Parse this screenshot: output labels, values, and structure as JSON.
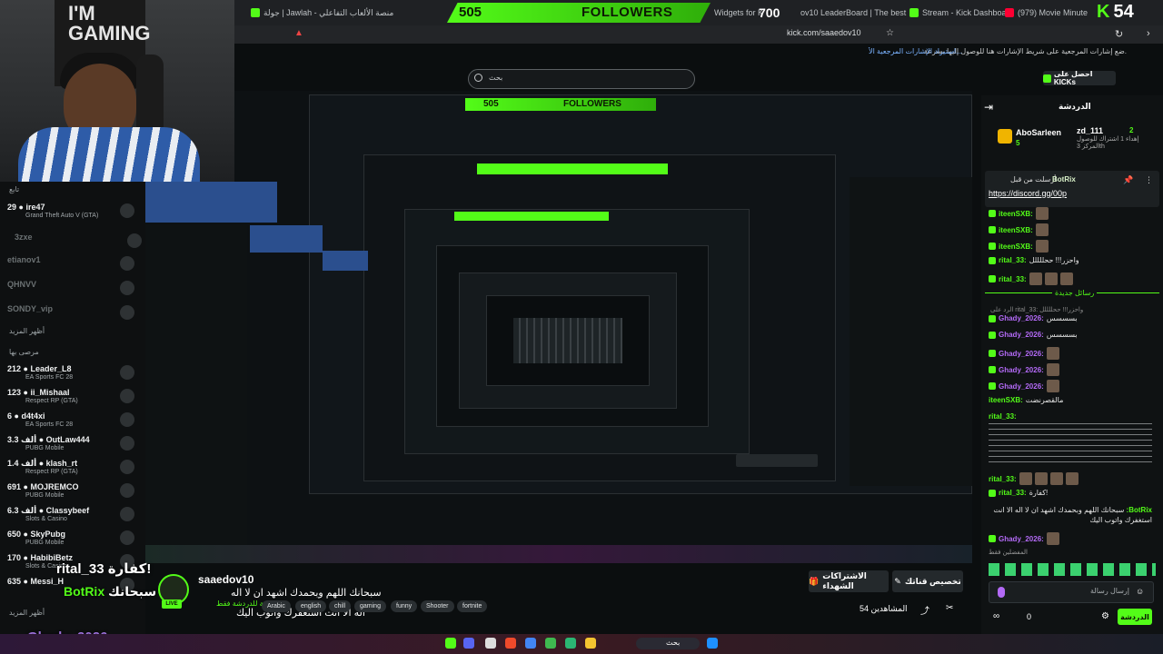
{
  "browser": {
    "tabs": [
      {
        "label": "جولة | Jawlah - منصة الألعاب التفاعلي",
        "x": 0
      },
      {
        "label": "Widgets for K",
        "x": 0
      },
      {
        "label": "ov10 LeaderBoard | The best",
        "x": 0
      },
      {
        "label": "Stream - Kick Dashboard",
        "x": 0
      },
      {
        "label": "(979) Movie Minute",
        "x": 0
      }
    ],
    "url": "kick.com/saaedov10",
    "bookmark_hint": "ضع إشارات المرجعية على شريط الإشارات هنا للوصول إليها بسرعة.",
    "bookmark_link": "استيراد الإشارات المرجعية الأ..."
  },
  "overlay": {
    "followers_count": "505",
    "followers_label": "FOLLOWERS",
    "counter": "700",
    "kick_count": "54",
    "kick_letter": "K",
    "cam_banner": "I'M\nGAMING"
  },
  "header": {
    "search_placeholder": "بحث",
    "get_kicks": "احصل على KICKs"
  },
  "sidebar": {
    "following_header": "تابع",
    "show_more_1": "أظهر المزيد",
    "recommended_header": "مرصى بها",
    "show_more_2": "أظهر المزيد",
    "items": [
      {
        "name": "ire47",
        "viewers": "29",
        "game": "Grand Theft Auto V (GTA)",
        "online": true
      },
      {
        "name": "3zxe",
        "viewers": "",
        "game": "",
        "online": false
      },
      {
        "name": "etianov1",
        "viewers": "",
        "game": "",
        "online": false
      },
      {
        "name": "QHNVV",
        "viewers": "",
        "game": "",
        "online": false
      },
      {
        "name": "SONDY_vip",
        "viewers": "",
        "game": "",
        "online": false
      }
    ],
    "recommended": [
      {
        "name": "Leader_L8",
        "viewers": "212",
        "game": "EA Sports FC 28"
      },
      {
        "name": "ii_Mishaal",
        "viewers": "123",
        "game": "Respect RP (GTA)"
      },
      {
        "name": "d4t4xi",
        "viewers": "6",
        "game": "EA Sports FC 28"
      },
      {
        "name": "OutLaw444",
        "viewers": "3.3 ألف",
        "game": "PUBG Mobile"
      },
      {
        "name": "klash_rt",
        "viewers": "1.4 ألف",
        "game": "Respect RP (GTA)"
      },
      {
        "name": "MOJREMCO",
        "viewers": "691",
        "game": "PUBG Mobile"
      },
      {
        "name": "Classybeef",
        "viewers": "6.3 ألف",
        "game": "Slots & Casino"
      },
      {
        "name": "SkyPubg",
        "viewers": "650",
        "game": "PUBG Mobile"
      },
      {
        "name": "HabibiBetz",
        "viewers": "170",
        "game": "Slots & Casino"
      },
      {
        "name": "Messi_H",
        "viewers": "635",
        "game": ""
      }
    ]
  },
  "chat": {
    "title": "الدردشة",
    "leaders": [
      {
        "name": "AboSarleen",
        "score": "5"
      },
      {
        "name": "zd_111",
        "score": "2",
        "note": "إهداء 1 اشتراك للوصول المركز 3th"
      }
    ],
    "pinned_label": "أرسلت من قبل",
    "pinned_user": "BotRix",
    "pinned_link": "https://discord.gg/00p",
    "messages_top": [
      {
        "user": "iteenSXB:",
        "text": "",
        "color": "#53fc18"
      },
      {
        "user": "iteenSXB:",
        "text": "",
        "color": "#53fc18"
      },
      {
        "user": "iteenSXB:",
        "text": "",
        "color": "#53fc18"
      },
      {
        "user": "rital_33:",
        "text": "واحزر!!! ححللللل",
        "color": "#53fc18"
      },
      {
        "user": "rital_33:",
        "text": "",
        "color": "#53fc18"
      }
    ],
    "new_messages_divider": "رسائل جديدة",
    "reply_preview": "الرد على rital_33: واحزر!!! ححللللل",
    "messages": [
      {
        "user": "Ghady_2026:",
        "text": "بسسسس",
        "color": "#b36af6"
      },
      {
        "user": "Ghady_2026:",
        "text": "بسسسس",
        "color": "#b36af6"
      },
      {
        "user": "Ghady_2026:",
        "text": "",
        "color": "#b36af6"
      },
      {
        "user": "Ghady_2026:",
        "text": "",
        "color": "#b36af6"
      },
      {
        "user": "Ghady_2026:",
        "text": "",
        "color": "#b36af6"
      },
      {
        "user": "iteenSXB:",
        "text": "مالقصرنضت",
        "color": "#53fc18"
      },
      {
        "user": "rital_33:",
        "text": "",
        "color": "#53fc18"
      },
      {
        "user": "rital_33:",
        "text": "",
        "color": "#53fc18"
      },
      {
        "user": "rital_33:",
        "text": "كفارة!",
        "color": "#53fc18"
      },
      {
        "user": "BotRix:",
        "text": "سبحانك اللهم وبحمدك اشهد ان لا اله الا انت استغفرك واتوب اليك",
        "color": "#53fc18"
      },
      {
        "user": "Ghady_2026:",
        "text": "",
        "color": "#b36af6"
      }
    ],
    "input_placeholder": "إرسال رسالة",
    "send_label": "الدردشة",
    "emote_label": "المفضلين فقط",
    "counter": "0"
  },
  "stream": {
    "streamer": "saaedov10",
    "live": "LIVE",
    "subtitle": "مخصصة للدردشة فقط",
    "title_line1": "سبحانك اللهم وبحمدك اشهد ان لا اله",
    "title_line2": "اله الا انت استغفرك واتوب اليك",
    "tags": [
      "Arabic",
      "english",
      "chill",
      "gaming",
      "funny",
      "Shooter",
      "fortnite"
    ],
    "subscriptions_btn": "الاشتراكات الشهداء",
    "customize_btn": "تخصيص قناتك",
    "viewers": "المشاهدين 54"
  },
  "overlay_chat": {
    "line1_user": "rital_33",
    "line1_text": "كفارة!",
    "line2_user": "BotRix",
    "line2_text": "سبحانك",
    "line3_user": "Ghady_2026"
  },
  "taskbar": {
    "search": "بحث"
  }
}
